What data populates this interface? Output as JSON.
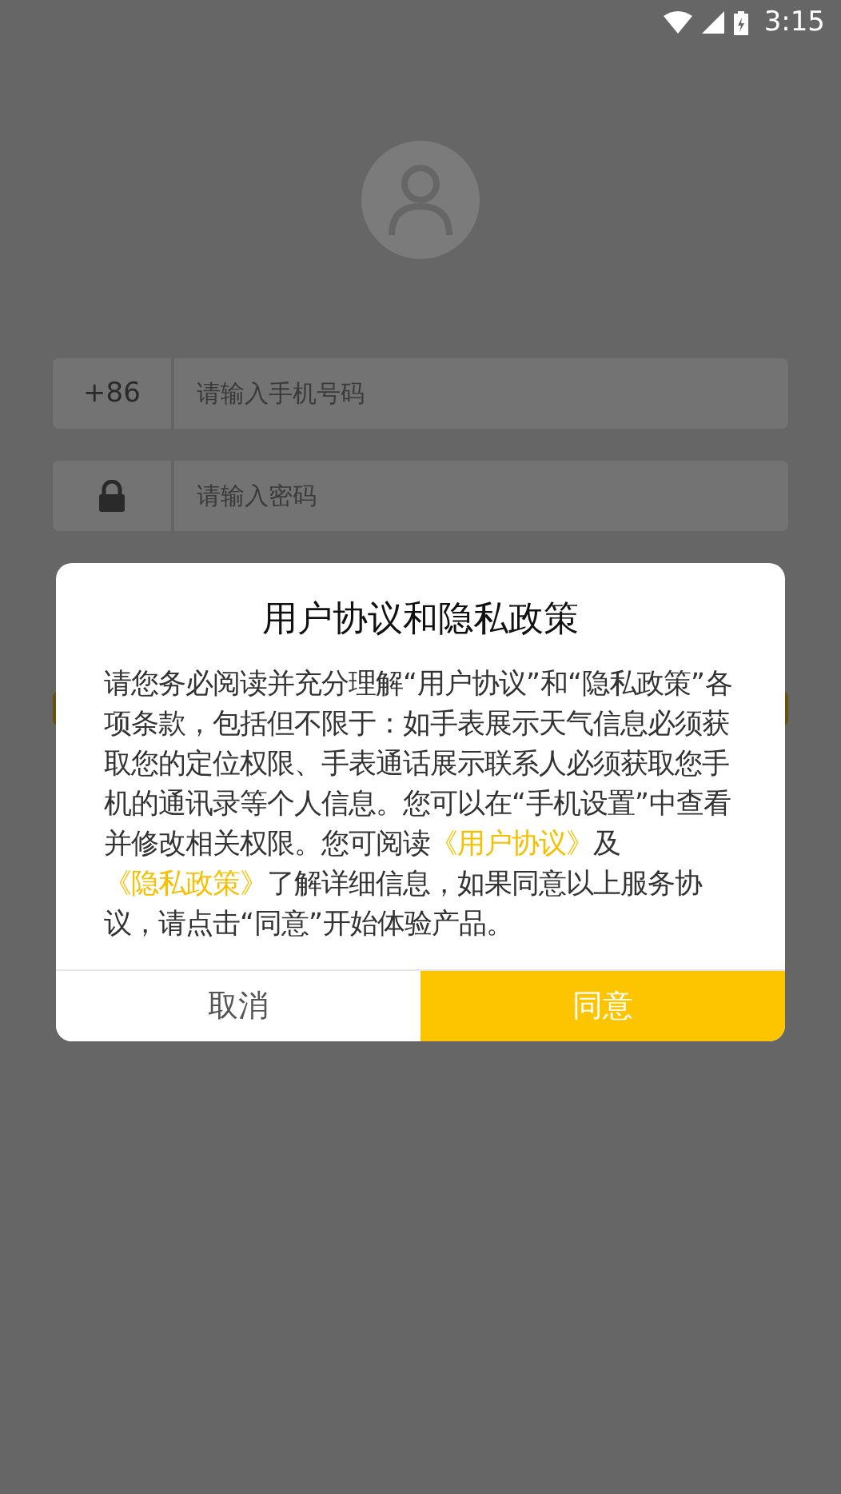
{
  "status_bar": {
    "time": "3:15"
  },
  "login_form": {
    "country_code": "+86",
    "phone_placeholder": "请输入手机号码",
    "password_placeholder": "请输入密码"
  },
  "dialog": {
    "title": "用户协议和隐私政策",
    "body": [
      {
        "kind": "text",
        "text": "请您务必阅读并充分理解“用户协议”和“隐私政策”各项条款，包括但不限于：如手表展示天气信息必须获取您的定位权限、手表通话展示联系人必须获取您手机的通讯录等个人信息。您可以在“手机设置”中查看并修改相关权限。您可阅读"
      },
      {
        "kind": "link",
        "text": "《用户协议》"
      },
      {
        "kind": "text",
        "text": "及"
      },
      {
        "kind": "link",
        "text": "《隐私政策》"
      },
      {
        "kind": "text",
        "text": "了解详细信息，如果同意以上服务协议，请点击“同意”开始体验产品。"
      }
    ],
    "buttons": [
      {
        "label": "取消",
        "kind": "secondary"
      },
      {
        "label": "同意",
        "kind": "primary"
      }
    ]
  }
}
